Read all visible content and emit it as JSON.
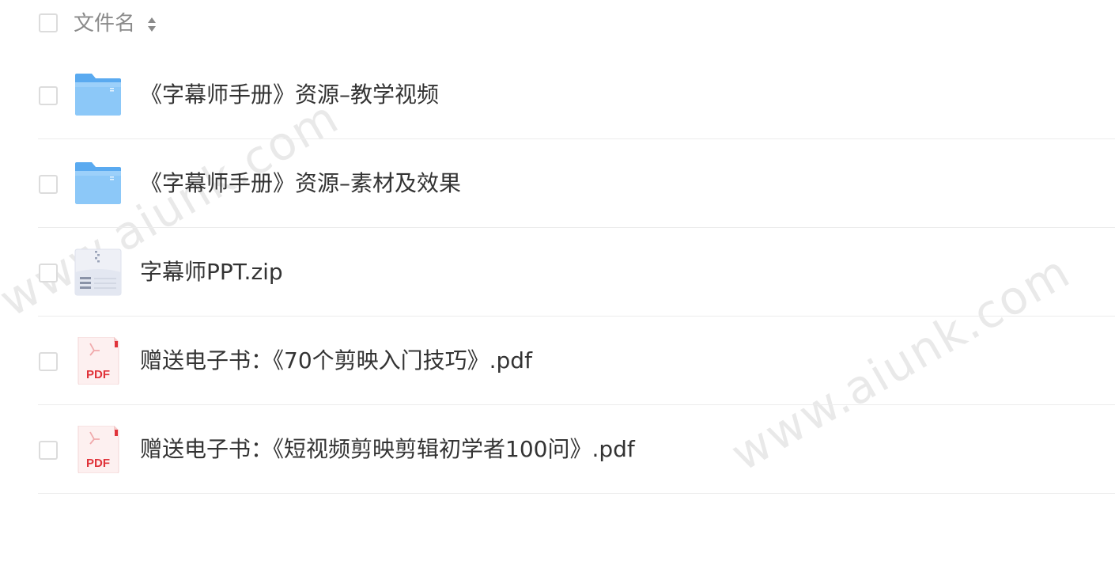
{
  "header": {
    "column_label": "文件名",
    "sort_icon": "sort-icon"
  },
  "files": [
    {
      "name": "《字幕师手册》资源–教学视频",
      "icon": "folder-icon"
    },
    {
      "name": "《字幕师手册》资源–素材及效果",
      "icon": "folder-icon"
    },
    {
      "name": "字幕师PPT.zip",
      "icon": "zip-file-icon"
    },
    {
      "name": "赠送电子书：《70个剪映入门技巧》.pdf",
      "icon": "pdf-file-icon",
      "icon_label": "PDF"
    },
    {
      "name": "赠送电子书：《短视频剪映剪辑初学者100问》.pdf",
      "icon": "pdf-file-icon",
      "icon_label": "PDF"
    }
  ],
  "watermark": "www.aiunk.com",
  "colors": {
    "folder": "#5aaaf0",
    "pdf_accent": "#e0333a",
    "text": "#333333",
    "header_text": "#8a8a8a"
  }
}
